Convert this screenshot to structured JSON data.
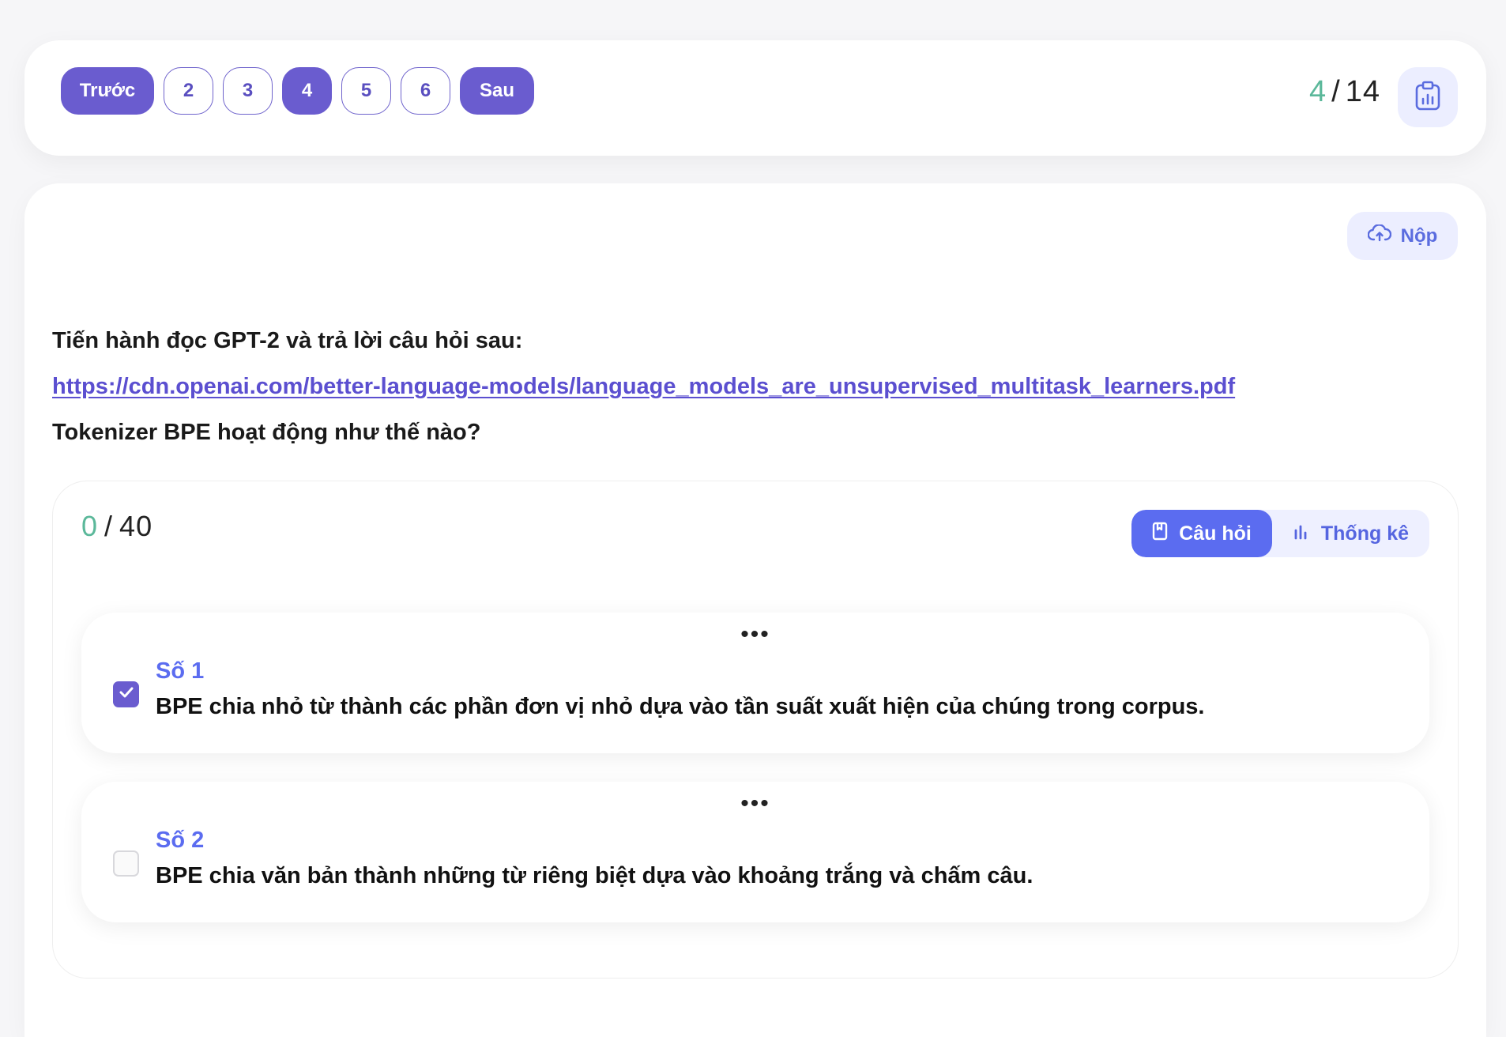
{
  "pager": {
    "prev_label": "Trước",
    "pages": [
      "2",
      "3",
      "4",
      "5",
      "6"
    ],
    "current_page": "4",
    "next_label": "Sau"
  },
  "progress": {
    "current": "4",
    "separator": "/",
    "total": "14"
  },
  "report_button": {
    "icon": "clipboard-chart-icon"
  },
  "submit": {
    "label": "Nộp",
    "icon": "cloud-upload-icon"
  },
  "question": {
    "intro": "Tiến hành đọc GPT-2 và trả lời câu hỏi sau:",
    "link": "https://cdn.openai.com/better-language-models/language_models_are_unsupervised_multitask_learners.pdf",
    "prompt": "Tokenizer BPE hoạt động như thế nào?"
  },
  "score": {
    "current": "0",
    "separator": "/",
    "total": "40"
  },
  "tabs": {
    "questions_label": "Câu hỏi",
    "questions_icon": "book-icon",
    "stats_label": "Thống kê",
    "stats_icon": "bar-chart-icon",
    "active": "questions"
  },
  "options": [
    {
      "label": "Số 1",
      "text": "BPE chia nhỏ từ thành các phần đơn vị nhỏ dựa vào tần suất xuất hiện của chúng trong corpus.",
      "checked": true
    },
    {
      "label": "Số 2",
      "text": "BPE chia văn bản thành những từ riêng biệt dựa vào khoảng trắng và chấm câu.",
      "checked": false
    }
  ],
  "colors": {
    "accent": "#6a5ccf",
    "tab_active": "#5b6cf0",
    "progress_current": "#5bb89a",
    "soft_bg": "#eceeff"
  }
}
